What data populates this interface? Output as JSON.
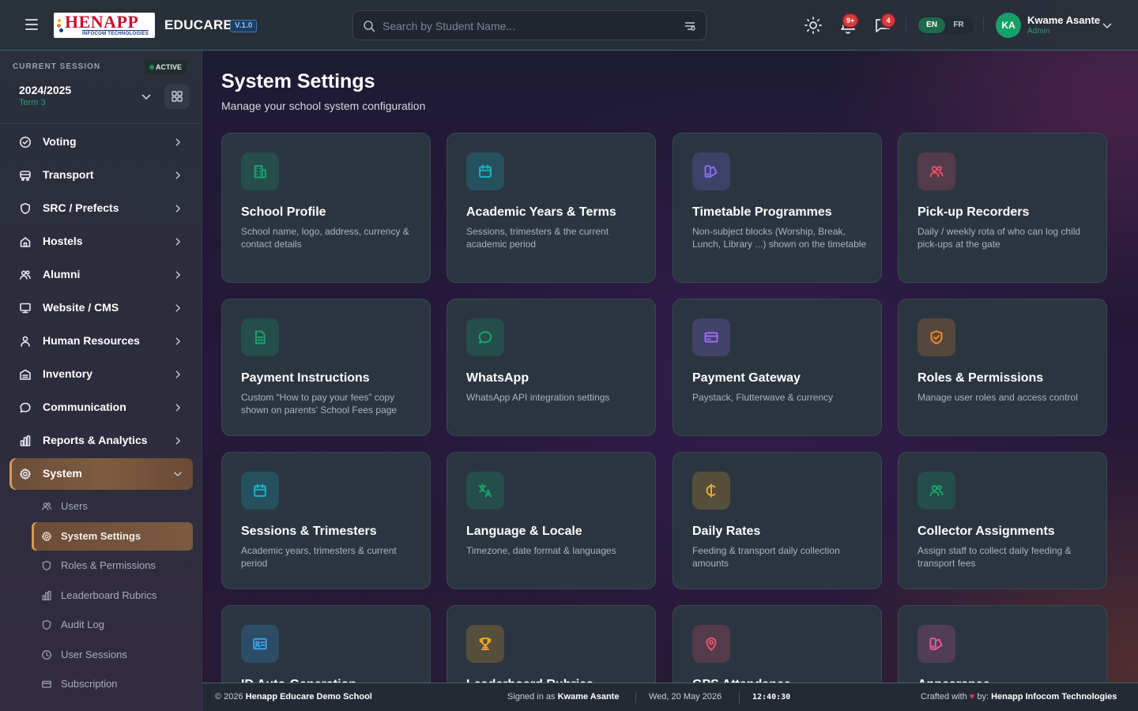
{
  "header": {
    "logo_main": "HENAPP",
    "logo_sub": "INFOCOM TECHNOLOGIES",
    "brand": "EDUCARE",
    "version": "V.1.0",
    "search_placeholder": "Search by Student Name...",
    "notifications_badge": "9+",
    "messages_badge": "4",
    "lang_en": "EN",
    "lang_fr": "FR",
    "avatar_initials": "KA",
    "user_name": "Kwame Asante",
    "user_role": "Admin"
  },
  "session": {
    "label": "CURRENT SESSION",
    "status": "ACTIVE",
    "year": "2024/2025",
    "term": "Term 3"
  },
  "sidebar": {
    "items": [
      {
        "label": "Voting",
        "icon": "check-circle-icon"
      },
      {
        "label": "Transport",
        "icon": "bus-icon"
      },
      {
        "label": "SRC / Prefects",
        "icon": "shield-icon"
      },
      {
        "label": "Hostels",
        "icon": "home-icon"
      },
      {
        "label": "Alumni",
        "icon": "users-icon"
      },
      {
        "label": "Website / CMS",
        "icon": "monitor-icon"
      },
      {
        "label": "Human Resources",
        "icon": "user-icon"
      },
      {
        "label": "Inventory",
        "icon": "warehouse-icon"
      },
      {
        "label": "Communication",
        "icon": "chat-icon"
      },
      {
        "label": "Reports & Analytics",
        "icon": "bar-chart-icon"
      },
      {
        "label": "System",
        "icon": "gear-icon"
      }
    ],
    "subitems": [
      {
        "label": "Users",
        "icon": "users-icon"
      },
      {
        "label": "System Settings",
        "icon": "gear-icon"
      },
      {
        "label": "Roles & Permissions",
        "icon": "shield-icon"
      },
      {
        "label": "Leaderboard Rubrics",
        "icon": "bar-chart-icon"
      },
      {
        "label": "Audit Log",
        "icon": "shield-icon"
      },
      {
        "label": "User Sessions",
        "icon": "clock-icon"
      },
      {
        "label": "Subscription",
        "icon": "card-icon"
      }
    ]
  },
  "main": {
    "title": "System Settings",
    "subtitle": "Manage your school system configuration",
    "cards": [
      {
        "title": "School Profile",
        "desc": "School name, logo, address, currency & contact details",
        "icon": "building-icon",
        "color": "#19a56d"
      },
      {
        "title": "Academic Years & Terms",
        "desc": "Sessions, trimesters & the current academic period",
        "icon": "calendar-icon",
        "color": "#19b3c4"
      },
      {
        "title": "Timetable Programmes",
        "desc": "Non-subject blocks (Worship, Break, Lunch, Library ...) shown on the timetable",
        "icon": "swatch-icon",
        "color": "#8a6cf0"
      },
      {
        "title": "Pick-up Recorders",
        "desc": "Daily / weekly rota of who can log child pick-ups at the gate",
        "icon": "users-icon",
        "color": "#e8506a"
      },
      {
        "title": "Payment Instructions",
        "desc": "Custom “How to pay your fees” copy shown on parents' School Fees page",
        "icon": "document-icon",
        "color": "#19a56d"
      },
      {
        "title": "WhatsApp",
        "desc": "WhatsApp API integration settings",
        "icon": "chat-icon",
        "color": "#19a56d"
      },
      {
        "title": "Payment Gateway",
        "desc": "Paystack, Flutterwave & currency",
        "icon": "credit-card-icon",
        "color": "#9a6cf0"
      },
      {
        "title": "Roles & Permissions",
        "desc": "Manage user roles and access control",
        "icon": "shield-check-icon",
        "color": "#f08a2a"
      },
      {
        "title": "Sessions & Trimesters",
        "desc": "Academic years, trimesters & current period",
        "icon": "calendar-icon",
        "color": "#19b3c4"
      },
      {
        "title": "Language & Locale",
        "desc": "Timezone, date format & languages",
        "icon": "translate-icon",
        "color": "#19a56d"
      },
      {
        "title": "Daily Rates",
        "desc": "Feeding & transport daily collection amounts",
        "icon": "cedi-icon",
        "color": "#f0a82a"
      },
      {
        "title": "Collector Assignments",
        "desc": "Assign staff to collect daily feeding & transport fees",
        "icon": "users-icon",
        "color": "#19a56d"
      },
      {
        "title": "ID Auto-Generation",
        "desc": "",
        "icon": "id-card-icon",
        "color": "#3aa0e8"
      },
      {
        "title": "Leaderboard Rubrics",
        "desc": "",
        "icon": "trophy-icon",
        "color": "#f0a82a"
      },
      {
        "title": "GPS Attendance",
        "desc": "",
        "icon": "map-pin-icon",
        "color": "#e8506a"
      },
      {
        "title": "Appearance",
        "desc": "",
        "icon": "swatch-icon",
        "color": "#e05aa0"
      }
    ]
  },
  "footer": {
    "copyright": "© 2026",
    "school": "Henapp Educare Demo School",
    "signed_in_prefix": "Signed in as",
    "signed_in_user": "Kwame Asante",
    "date": "Wed, 20 May 2026",
    "time": "12:40:30",
    "crafted_prefix": "Crafted with",
    "crafted_suffix": "by:",
    "company": "Henapp Infocom Technologies"
  }
}
